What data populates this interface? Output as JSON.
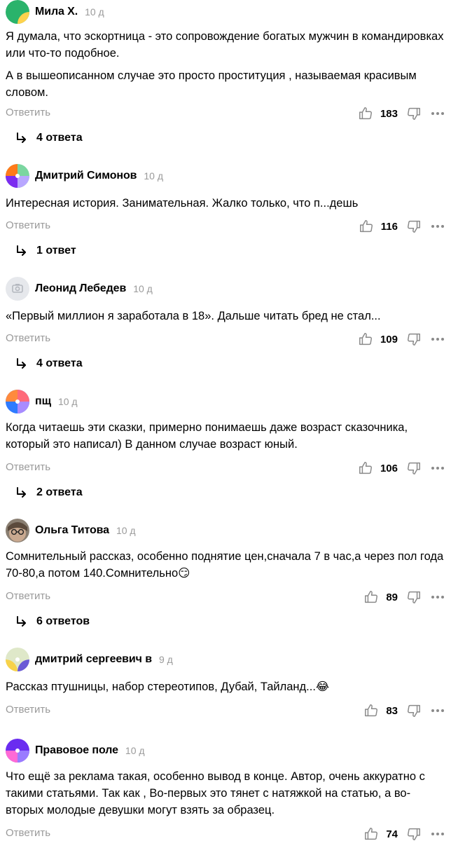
{
  "reply_label": "Ответить",
  "comments": [
    {
      "author": "Мила Х.",
      "date": "10 д",
      "text": [
        "Я думала, что эскортница - это сопровождение богатых мужчин в командировках или что-то подобное.",
        "А в вышеописанном случае это просто проституция , называемая красивым словом."
      ],
      "likes": "183",
      "replies": "4 ответа"
    },
    {
      "author": "Дмитрий Симонов",
      "date": "10 д",
      "text": [
        "Интересная история. Занимательная. Жалко только, что п...дешь"
      ],
      "likes": "116",
      "replies": "1 ответ"
    },
    {
      "author": "Леонид Лебедев",
      "date": "10 д",
      "text": [
        "«Первый миллион я заработала в 18». Дальше читать бред не стал..."
      ],
      "likes": "109",
      "replies": "4 ответа"
    },
    {
      "author": "пщ",
      "date": "10 д",
      "text": [
        "Когда читаешь эти сказки, примерно понимаешь даже возраст сказочника, который это написал) В данном случае возраст юный."
      ],
      "likes": "106",
      "replies": "2 ответа"
    },
    {
      "author": "Ольга Титова",
      "date": "10 д",
      "text": [
        "Сомнительный рассказ, особенно поднятие цен,сначала 7 в час,а через пол года 70-80,а потом 140.Сомнительно😏"
      ],
      "likes": "89",
      "replies": "6 ответов"
    },
    {
      "author": "дмитрий сергеевич в",
      "date": "9 д",
      "text": [
        "Рассказ птушницы, набор стереотипов, Дубай, Тайланд...😂"
      ],
      "likes": "83"
    },
    {
      "author": "Правовое поле",
      "date": "10 д",
      "text": [
        "Что ещё за реклама такая, особенно вывод в конце. Автор, очень аккуратно с такими статьями. Так как , Во-первых это тянет с натяжкой на статью, а во-вторых молодые девушки могут взять за образец."
      ],
      "likes": "74"
    }
  ],
  "colors": {
    "secondary_text": "#9a9a9a",
    "icon_gray": "#8a8a8a"
  }
}
